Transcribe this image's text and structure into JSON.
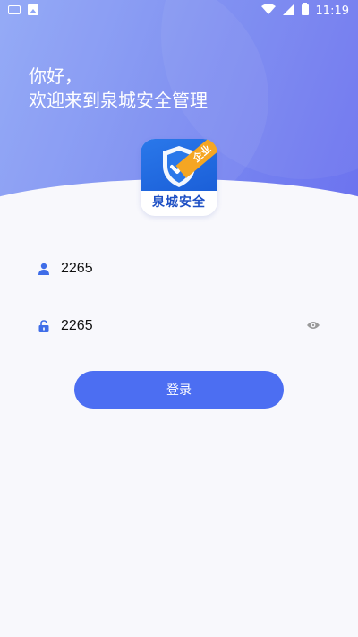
{
  "status_bar": {
    "time": "11:19",
    "left_icons": [
      "keyboard-icon",
      "image-icon"
    ],
    "right_icons": [
      "wifi-icon",
      "signal-icon",
      "battery-icon"
    ]
  },
  "greeting": {
    "line1": "你好，",
    "line2": "欢迎来到泉城安全管理"
  },
  "logo": {
    "badge": "企业",
    "name": "泉城安全"
  },
  "form": {
    "username_value": "2265",
    "password_value": "2265",
    "login_label": "登录"
  },
  "colors": {
    "accent": "#4c6ef2",
    "header_gradient_start": "#8fa6f6",
    "header_gradient_end": "#6c73ef"
  }
}
